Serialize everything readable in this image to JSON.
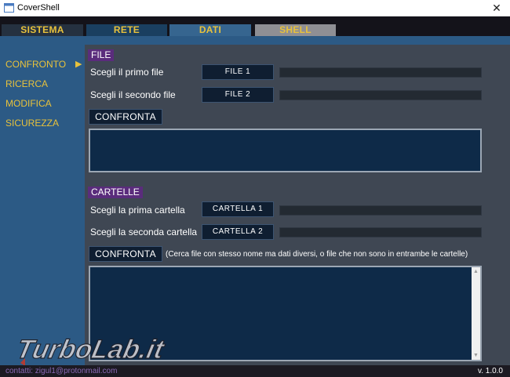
{
  "window": {
    "title": "CoverShell",
    "close_glyph": "✕"
  },
  "tabs": [
    {
      "label": "SISTEMA"
    },
    {
      "label": "RETE"
    },
    {
      "label": "DATI"
    },
    {
      "label": "SHELL"
    }
  ],
  "sidebar": {
    "items": [
      {
        "label": "CONFRONTO"
      },
      {
        "label": "RICERCA"
      },
      {
        "label": "MODIFICA"
      },
      {
        "label": "SICUREZZA"
      }
    ],
    "active_arrow": "▶"
  },
  "file_section": {
    "title": "FILE",
    "first_label": "Scegli il primo file",
    "first_button": "FILE 1",
    "second_label": "Scegli il secondo file",
    "second_button": "FILE 2",
    "compare_button": "CONFRONTA"
  },
  "folder_section": {
    "title": "CARTELLE",
    "first_label": "Scegli la prima cartella",
    "first_button": "CARTELLA 1",
    "second_label": "Scegli la seconda cartella",
    "second_button": "CARTELLA 2",
    "compare_button": "CONFRONTA",
    "note": "(Cerca file con stesso nome ma dati diversi, o file che non sono in entrambe le cartelle)"
  },
  "footer": {
    "contact": "contatti: zigul1@protonmail.com",
    "version": "v. 1.0.0"
  },
  "watermark": {
    "text": "TurboLab.it"
  },
  "colors": {
    "accent_yellow": "#e8c23c",
    "sidebar_blue": "#2c5a85",
    "section_purple": "#5a2c7c",
    "output_navy": "#0e2a48"
  }
}
